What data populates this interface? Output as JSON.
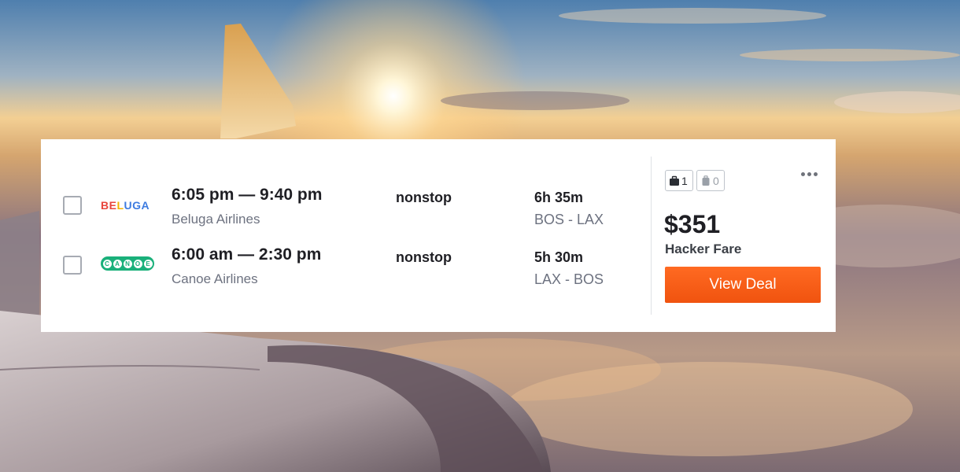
{
  "results": [
    {
      "logo_text": "BELUGA",
      "times": "6:05 pm — 9:40 pm",
      "airline": "Beluga Airlines",
      "stops": "nonstop",
      "duration": "6h 35m",
      "route": "BOS - LAX"
    },
    {
      "logo_text": "CANOE",
      "times": "6:00 am — 2:30 pm",
      "airline": "Canoe Airlines",
      "stops": "nonstop",
      "duration": "5h 30m",
      "route": "LAX - BOS"
    }
  ],
  "bags": {
    "carry_on_count": "1",
    "checked_count": "0",
    "carry_on_icon": "carry-on-bag-icon",
    "checked_icon": "checked-bag-icon"
  },
  "offer": {
    "price": "$351",
    "fare_type": "Hacker Fare",
    "button_label": "View Deal"
  },
  "more_icon": "more-options-icon",
  "colors": {
    "accent": "#ff5a1a",
    "canoe_brand": "#1ab07a",
    "beluga_letters": [
      "#e8453c",
      "#e8453c",
      "#f4b400",
      "#3d7be0",
      "#3d7be0",
      "#3d7be0"
    ]
  }
}
